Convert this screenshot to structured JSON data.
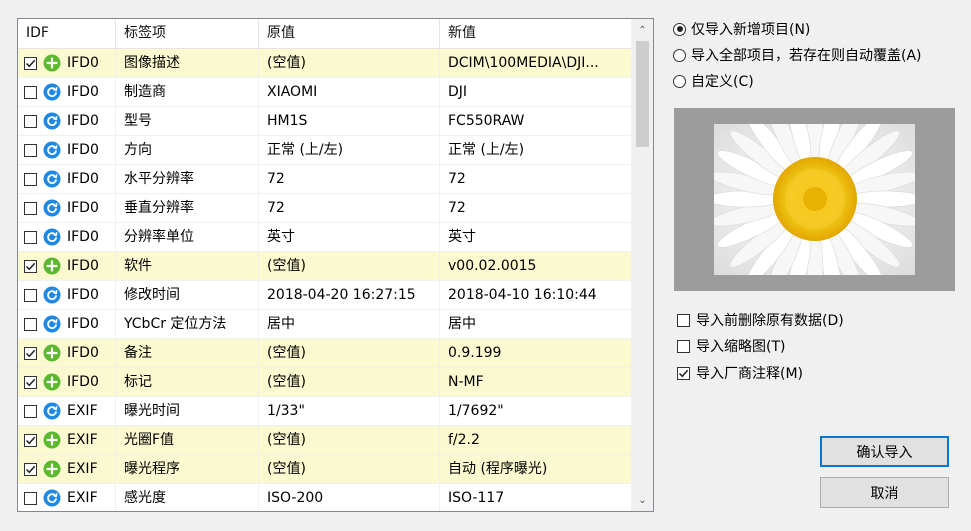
{
  "table": {
    "columns": [
      "IDF",
      "标签项",
      "原值",
      "新值"
    ],
    "rows": [
      {
        "checked": true,
        "icon": "plus-circle-icon",
        "idf": "IFD0",
        "tag": "图像描述",
        "old": "(空值)",
        "new": "DCIM\\100MEDIA\\DJI..."
      },
      {
        "checked": false,
        "icon": "refresh-circle-icon",
        "idf": "IFD0",
        "tag": "制造商",
        "old": "XIAOMI",
        "new": "DJI"
      },
      {
        "checked": false,
        "icon": "refresh-circle-icon",
        "idf": "IFD0",
        "tag": "型号",
        "old": "HM1S",
        "new": "FC550RAW"
      },
      {
        "checked": false,
        "icon": "refresh-circle-icon",
        "idf": "IFD0",
        "tag": "方向",
        "old": "正常 (上/左)",
        "new": "正常 (上/左)"
      },
      {
        "checked": false,
        "icon": "refresh-circle-icon",
        "idf": "IFD0",
        "tag": "水平分辨率",
        "old": "72",
        "new": "72"
      },
      {
        "checked": false,
        "icon": "refresh-circle-icon",
        "idf": "IFD0",
        "tag": "垂直分辨率",
        "old": "72",
        "new": "72"
      },
      {
        "checked": false,
        "icon": "refresh-circle-icon",
        "idf": "IFD0",
        "tag": "分辨率单位",
        "old": "英寸",
        "new": "英寸"
      },
      {
        "checked": true,
        "icon": "plus-circle-icon",
        "idf": "IFD0",
        "tag": "软件",
        "old": "(空值)",
        "new": "v00.02.0015"
      },
      {
        "checked": false,
        "icon": "refresh-circle-icon",
        "idf": "IFD0",
        "tag": "修改时间",
        "old": "2018-04-20 16:27:15",
        "new": "2018-04-10 16:10:44"
      },
      {
        "checked": false,
        "icon": "refresh-circle-icon",
        "idf": "IFD0",
        "tag": "YCbCr 定位方法",
        "old": "居中",
        "new": "居中"
      },
      {
        "checked": true,
        "icon": "plus-circle-icon",
        "idf": "IFD0",
        "tag": "备注",
        "old": "(空值)",
        "new": "0.9.199"
      },
      {
        "checked": true,
        "icon": "plus-circle-icon",
        "idf": "IFD0",
        "tag": "标记",
        "old": "(空值)",
        "new": "N-MF"
      },
      {
        "checked": false,
        "icon": "refresh-circle-icon",
        "idf": "EXIF",
        "tag": "曝光时间",
        "old": "1/33\"",
        "new": "1/7692\""
      },
      {
        "checked": true,
        "icon": "plus-circle-icon",
        "idf": "EXIF",
        "tag": "光圈F值",
        "old": "(空值)",
        "new": "f/2.2"
      },
      {
        "checked": true,
        "icon": "plus-circle-icon",
        "idf": "EXIF",
        "tag": "曝光程序",
        "old": "(空值)",
        "new": "自动 (程序曝光)"
      },
      {
        "checked": false,
        "icon": "refresh-circle-icon",
        "idf": "EXIF",
        "tag": "感光度",
        "old": "ISO-200",
        "new": "ISO-117"
      }
    ]
  },
  "import_mode": {
    "options": [
      {
        "label": "仅导入新增项目(N)",
        "selected": true
      },
      {
        "label": "导入全部项目，若存在则自动覆盖(A)",
        "selected": false
      },
      {
        "label": "自定义(C)",
        "selected": false
      }
    ]
  },
  "preview": {
    "image": "daisy-flower-photo"
  },
  "options": [
    {
      "label": "导入前删除原有数据(D)",
      "checked": false
    },
    {
      "label": "导入缩略图(T)",
      "checked": false
    },
    {
      "label": "导入厂商注释(M)",
      "checked": true
    }
  ],
  "buttons": {
    "confirm": "确认导入",
    "cancel": "取消"
  },
  "colors": {
    "selected_row": "#fbf9cf",
    "plus_icon": "#5cb82e",
    "refresh_icon": "#1e88e5",
    "accent": "#0078d7"
  }
}
